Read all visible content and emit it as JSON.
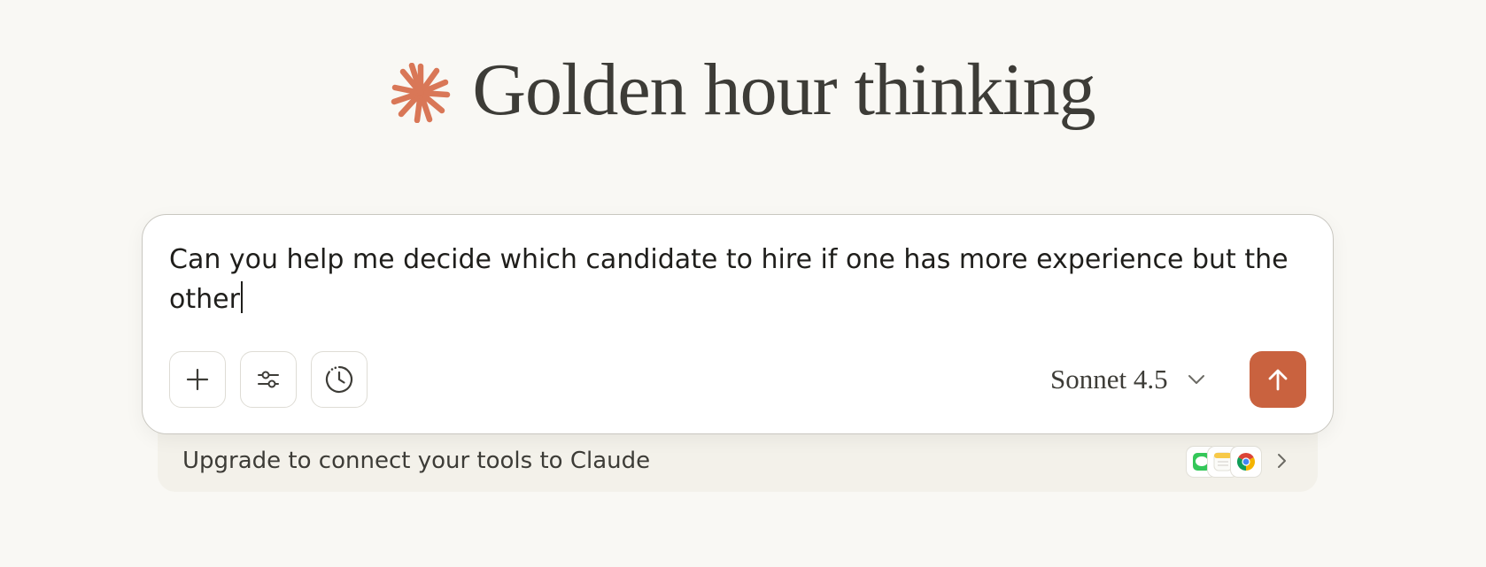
{
  "greeting": {
    "icon": "claude-spark-icon",
    "title": "Golden hour thinking",
    "accent_color": "#d97757"
  },
  "composer": {
    "prompt_value": "Can you help me decide which candidate to hire if one has more experience but the other",
    "tools": [
      {
        "name": "add-button",
        "icon": "plus-icon"
      },
      {
        "name": "settings-button",
        "icon": "sliders-icon"
      },
      {
        "name": "history-button",
        "icon": "clock-icon"
      }
    ],
    "model": {
      "label": "Sonnet 4.5",
      "icon": "chevron-down-icon"
    },
    "send": {
      "icon": "arrow-up-icon",
      "color": "#c9623f"
    }
  },
  "upgrade_banner": {
    "text": "Upgrade to connect your tools to Claude",
    "app_icons": [
      "messages-icon",
      "notes-icon",
      "chrome-icon"
    ],
    "chevron": "chevron-right-icon"
  },
  "colors": {
    "background": "#f9f8f4",
    "text": "#3d3c37",
    "banner_background": "#f3f1ea"
  }
}
